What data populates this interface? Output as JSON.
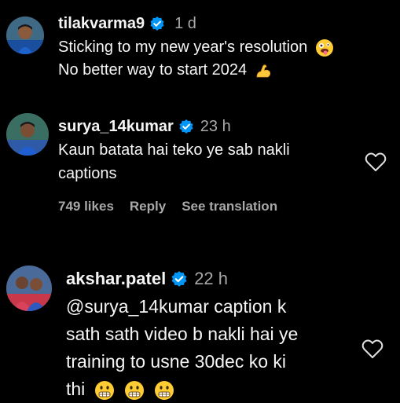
{
  "comments": [
    {
      "username": "tilakvarma9",
      "time": "1 d",
      "lines": [
        "Sticking to my new year's resolution",
        "No better way to start 2024"
      ],
      "line_emojis": [
        "zany-face-emoji",
        "flexed-biceps-emoji"
      ],
      "avatar": "avatar-tilakvarma9"
    },
    {
      "username": "surya_14kumar",
      "time": "23 h",
      "lines": [
        "Kaun batata hai teko ye sab nakli",
        "captions"
      ],
      "likes": "749 likes",
      "reply_label": "Reply",
      "translate_label": "See translation",
      "avatar": "avatar-surya_14kumar"
    },
    {
      "username": "akshar.patel",
      "time": "22 h",
      "lines": [
        "@surya_14kumar caption k",
        "sath sath video b nakli hai ye",
        "training to usne 30dec ko ki",
        "thi"
      ],
      "trailing_emojis": [
        "grimacing-face-emoji",
        "grimacing-face-emoji",
        "grimacing-face-emoji"
      ],
      "avatar": "avatar-akshar.patel"
    }
  ],
  "colors": {
    "background": "#000000",
    "text": "#f5f5f5",
    "secondary": "#a8a8a8",
    "verified_blue": "#0095f6"
  }
}
